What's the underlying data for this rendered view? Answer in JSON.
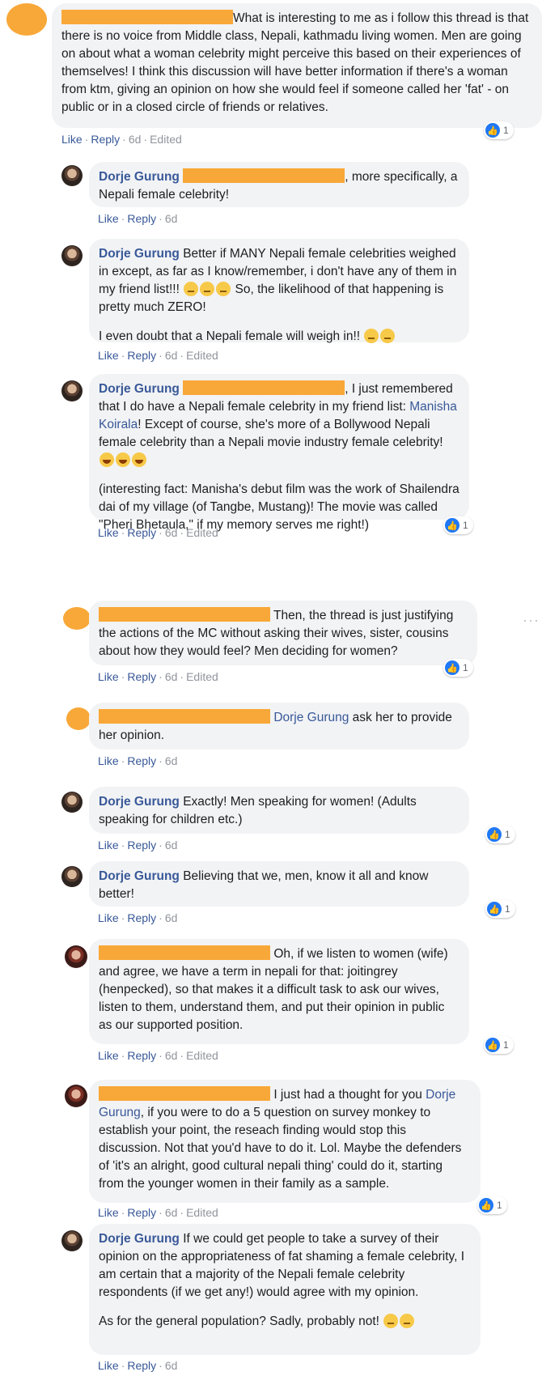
{
  "actions": {
    "like": "Like",
    "reply": "Reply",
    "time": "6d",
    "edited": "Edited",
    "dot": "·"
  },
  "reaction_count": "1",
  "more_label": "···",
  "comments": [
    {
      "avatar": "orange",
      "text": "What is interesting to me as i follow this thread is that there is no voice from Middle class, Nepali, kathmadu living women. Men are going on about what a woman celebrity might perceive this based on their experiences of themselves! I think this discussion will have better information if there's a woman from ktm, giving an opinion on how she would feel if someone called her 'fat' - on public or in a closed circle of friends or relatives."
    },
    {
      "name": "Dorje Gurung",
      "text": ", more specifically, a Nepali female celebrity!"
    },
    {
      "name": "Dorje Gurung",
      "text_a": "Better if MANY Nepali female celebrities weighed in except, as far as I know/remember, i don't have any of them in my friend list!!!",
      "text_b": "So, the likelihood of that happening is pretty much ZERO!",
      "text_c": "I even doubt that a Nepali female will weigh in!!"
    },
    {
      "name": "Dorje Gurung",
      "text_a": ", I just remembered that I do have a Nepali female celebrity in my friend list:",
      "mention": "Manisha Koirala",
      "text_b": "! Except of course, she's more of a Bollywood Nepali female celebrity than a Nepali movie industry female celebrity!",
      "text_c": "(interesting fact: Manisha's debut film was the work of Shailendra dai of my village (of Tangbe, Mustang)! The movie was called \"Pheri Bhetaula,\" if my memory serves me right!)"
    },
    {
      "text": "Then, the thread is just justifying the actions of the MC without asking their wives, sister, cousins about how they would feel? Men deciding for women?"
    },
    {
      "mention": "Dorje Gurung",
      "text": "ask her to provide her opinion."
    },
    {
      "name": "Dorje Gurung",
      "text": "Exactly! Men speaking for women! (Adults speaking for children etc.)"
    },
    {
      "name": "Dorje Gurung",
      "text": "Believing that we, men, know it all and know better!"
    },
    {
      "text": "Oh, if we listen to women (wife) and agree, we have a term in nepali for that: joitingrey (henpecked), so that makes it a difficult task to ask our wives, listen to them, understand them, and put their opinion in public as our supported position."
    },
    {
      "text_a": "I just had a thought for you",
      "mention": "Dorje Gurung",
      "text_b": ", if you were to do a 5 question on survey monkey to establish your point, the reseach finding would stop this discussion. Not that you'd have to do it. Lol. Maybe the defenders of 'it's an alright, good cultural nepali thing' could do it, starting from the younger women in their family as a sample."
    },
    {
      "name": "Dorje Gurung",
      "text_a": "If we could get people to take a survey of their opinion on the appropriateness of fat shaming a female celebrity, I am certain that a majority of the Nepali female celebrity respondents (if we get any!) would agree with my opinion.",
      "text_b": "As for the general population? Sadly, probably not!"
    }
  ]
}
